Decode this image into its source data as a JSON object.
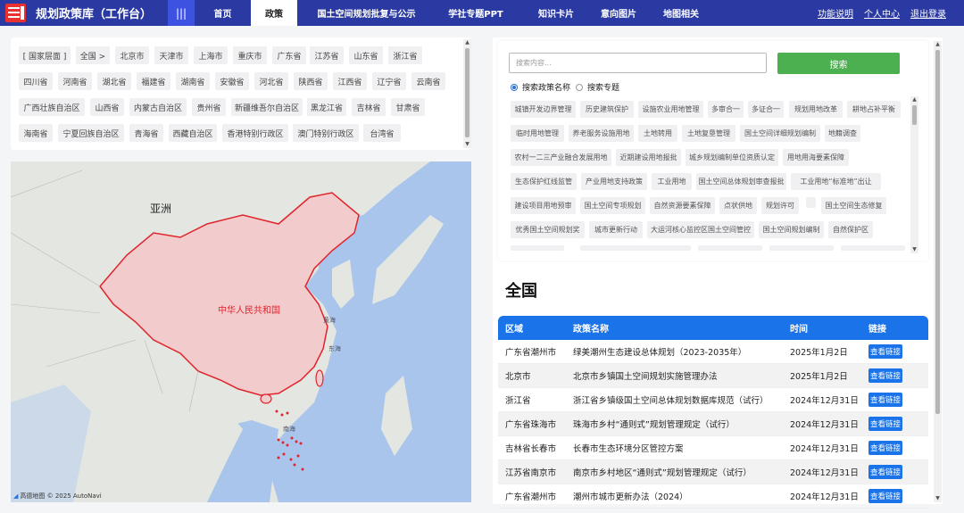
{
  "header": {
    "app_title": "规划政策库（工作台）",
    "menu_icon": "grid-menu-icon",
    "nav": [
      {
        "label": "首页",
        "active": false
      },
      {
        "label": "政策",
        "active": true
      },
      {
        "label": "国土空间规划批复与公示",
        "active": false
      },
      {
        "label": "学社专题PPT",
        "active": false
      },
      {
        "label": "知识卡片",
        "active": false
      },
      {
        "label": "意向图片",
        "active": false
      },
      {
        "label": "地图相关",
        "active": false
      }
    ],
    "user_links": [
      "功能说明",
      "个人中心",
      "退出登录"
    ]
  },
  "regions": [
    "[ 国家层面 ]",
    "全国 >",
    "北京市",
    "天津市",
    "上海市",
    "重庆市",
    "广东省",
    "江苏省",
    "山东省",
    "浙江省",
    "四川省",
    "河南省",
    "湖北省",
    "福建省",
    "湖南省",
    "安徽省",
    "河北省",
    "陕西省",
    "江西省",
    "辽宁省",
    "云南省",
    "广西壮族自治区",
    "山西省",
    "内蒙古自治区",
    "贵州省",
    "新疆维吾尔自治区",
    "黑龙江省",
    "吉林省",
    "甘肃省",
    "海南省",
    "宁夏回族自治区",
    "青海省",
    "西藏自治区",
    "香港特别行政区",
    "澳门特别行政区",
    "台湾省"
  ],
  "map": {
    "labels": {
      "asia": "亚洲",
      "china": "中华人民共和国",
      "yellow_sea": "黄海",
      "east_sea": "东海",
      "south_sea": "南海"
    },
    "attribution": "高德地图 © 2025 AutoNavi"
  },
  "search": {
    "placeholder": "搜索内容...",
    "button": "搜索",
    "options": [
      {
        "label": "搜索政策名称",
        "checked": true
      },
      {
        "label": "搜索专题",
        "checked": false
      }
    ],
    "tags": [
      "城镇开发边界管理",
      "历史建筑保护",
      "设施农业用地管理",
      "多审合一",
      "多证合一",
      "规划用地改革",
      "耕地占补平衡",
      "临时用地管理",
      "养老服务设施用地",
      "土地转用",
      "土地复垦管理",
      "国土空间详细规划编制",
      "地籍调查",
      "农村一二三产业融合发展用地",
      "近期建设用地报批",
      "城乡规划编制单位资质认定",
      "用地用海要素保障",
      "生态保护红线监管",
      "产业用地支持政策",
      "工业用地",
      "国土空间总体规划审查报批",
      "工业用地“标准地”出让",
      "建设项目用地预审",
      "国土空间专项规划",
      "自然资源要素保障",
      "点状供地",
      "规划许可",
      "",
      "国土空间生态修复",
      "优秀国土空间规划奖",
      "城市更新行动",
      "大运河核心监控区国土空间管控",
      "国土空间规划编制",
      "自然保护区"
    ]
  },
  "policies": {
    "region_title": "全国",
    "columns": [
      "区域",
      "政策名称",
      "时间",
      "链接"
    ],
    "rows": [
      {
        "region": "广东省潮州市",
        "name": "绿美潮州生态建设总体规划（2023-2035年）",
        "date": "2025年1月2日",
        "link": "查看链接"
      },
      {
        "region": "北京市",
        "name": "北京市乡镇国土空间规划实施管理办法",
        "date": "2025年1月2日",
        "link": "查看链接"
      },
      {
        "region": "浙江省",
        "name": "浙江省乡镇级国土空间总体规划数据库规范（试行）",
        "date": "2024年12月31日",
        "link": "查看链接"
      },
      {
        "region": "广东省珠海市",
        "name": "珠海市乡村“通则式”规划管理规定（试行）",
        "date": "2024年12月31日",
        "link": "查看链接"
      },
      {
        "region": "吉林省长春市",
        "name": "长春市生态环境分区管控方案",
        "date": "2024年12月31日",
        "link": "查看链接"
      },
      {
        "region": "江苏省南京市",
        "name": "南京市乡村地区“通则式”规划管理规定（试行）",
        "date": "2024年12月31日",
        "link": "查看链接"
      },
      {
        "region": "广东省潮州市",
        "name": "潮州市城市更新办法（2024）",
        "date": "2024年12月31日",
        "link": "查看链接"
      }
    ]
  }
}
